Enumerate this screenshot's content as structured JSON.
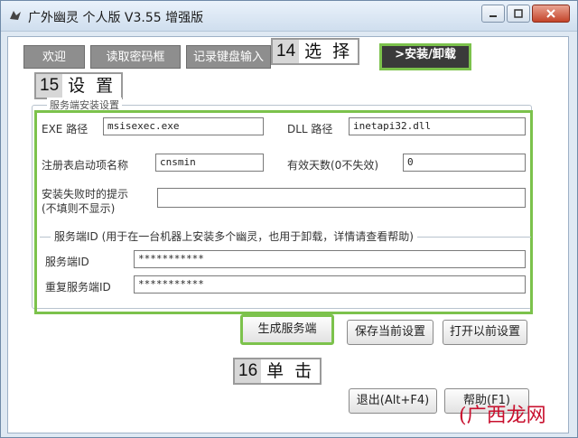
{
  "window": {
    "title": "广外幽灵 个人版 V3.55 增强版"
  },
  "tabs": [
    {
      "label": "欢迎"
    },
    {
      "label": "读取密码框"
    },
    {
      "label": "记录键盘输入"
    },
    {
      "label": ">安装/卸载",
      "active": true
    }
  ],
  "callouts": {
    "c14": {
      "num": "14",
      "word": "选 择"
    },
    "c15": {
      "num": "15",
      "word": "设 置"
    },
    "c16": {
      "num": "16",
      "word": "单 击"
    }
  },
  "settings": {
    "legend": "服务端安装设置",
    "exe_label": "EXE 路径",
    "exe_value": "msisexec.exe",
    "dll_label": "DLL 路径",
    "dll_value": "inetapi32.dll",
    "reg_label": "注册表启动项名称",
    "reg_value": "cnsmin",
    "days_label": "有效天数(0不失效)",
    "days_value": "0",
    "fail_label_1": "安装失败时的提示",
    "fail_label_2": "(不填则不显示)",
    "fail_value": ""
  },
  "server_id": {
    "legend": "服务端ID (用于在一台机器上安装多个幽灵，也用于卸载，详情请查看帮助)",
    "id_label": "服务端ID",
    "id_value": "***********",
    "repeat_label": "重复服务端ID",
    "repeat_value": "***********"
  },
  "buttons": {
    "generate": "生成服务端",
    "save": "保存当前设置",
    "open": "打开以前设置",
    "exit": "退出(Alt+F4)",
    "help": "帮助(F1)"
  },
  "watermark": {
    "paren_left": "(",
    "brand": "广西龙网",
    "text": "广西龙网"
  },
  "colors": {
    "highlight": "#7cc24c",
    "tab_inactive": "#8e8e8e",
    "tab_active": "#3a3a3a"
  }
}
